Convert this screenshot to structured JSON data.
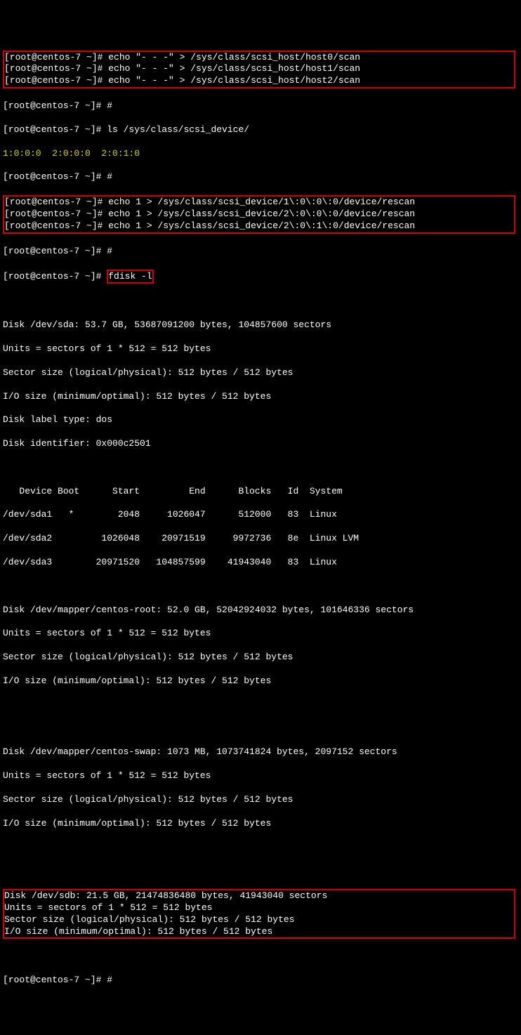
{
  "prompts": {
    "p1": "[root@centos-7 ~]# ",
    "hash": "#"
  },
  "cmd": {
    "echo_scan0": "echo \"- - -\" > /sys/class/scsi_host/host0/scan",
    "echo_scan1": "echo \"- - -\" > /sys/class/scsi_host/host1/scan",
    "echo_scan2": "echo \"- - -\" > /sys/class/scsi_host/host2/scan",
    "ls_scsi": "ls /sys/class/scsi_device/",
    "ls_out": "1:0:0:0  2:0:0:0  2:0:1:0",
    "rescan1": "echo 1 > /sys/class/scsi_device/1\\:0\\:0\\:0/device/rescan",
    "rescan2": "echo 1 > /sys/class/scsi_device/2\\:0\\:0\\:0/device/rescan",
    "rescan3": "echo 1 > /sys/class/scsi_device/2\\:0\\:1\\:0/device/rescan",
    "fdisk": "fdisk -l"
  },
  "fdisk_out": {
    "sda_header": "Disk /dev/sda: 53.7 GB, 53687091200 bytes, 104857600 sectors",
    "units": "Units = sectors of 1 * 512 = 512 bytes",
    "sector": "Sector size (logical/physical): 512 bytes / 512 bytes",
    "io": "I/O size (minimum/optimal): 512 bytes / 512 bytes",
    "label_type": "Disk label type: dos",
    "identifier": "Disk identifier: 0x000c2501",
    "table_header": "   Device Boot      Start         End      Blocks   Id  System",
    "sda1": "/dev/sda1   *        2048     1026047      512000   83  Linux",
    "sda2": "/dev/sda2         1026048    20971519     9972736   8e  Linux LVM",
    "sda3": "/dev/sda3        20971520   104857599    41943040   83  Linux",
    "root_header": "Disk /dev/mapper/centos-root: 52.0 GB, 52042924032 bytes, 101646336 sectors",
    "swap_header": "Disk /dev/mapper/centos-swap: 1073 MB, 1073741824 bytes, 2097152 sectors",
    "sdb_header": "Disk /dev/sdb: 21.5 GB, 21474836480 bytes, 41943040 sectors"
  }
}
